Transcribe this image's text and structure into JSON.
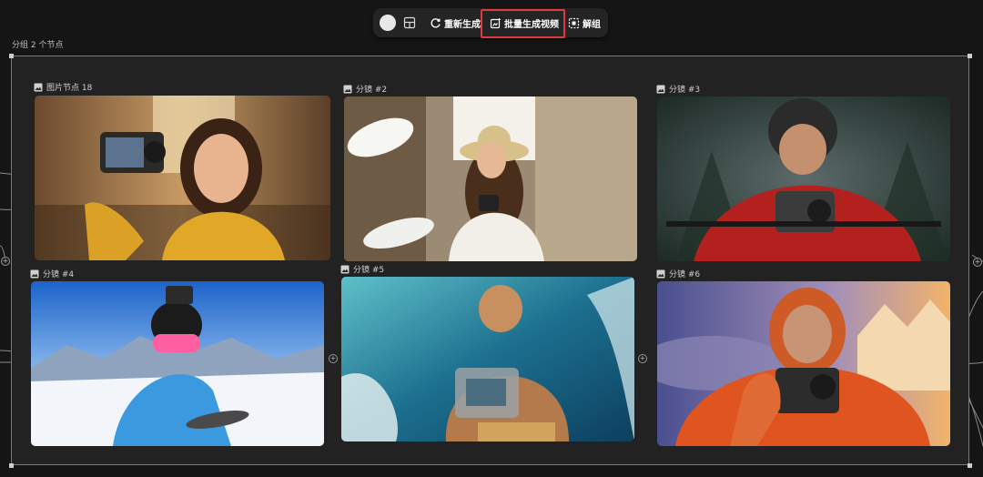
{
  "toolbar": {
    "color_swatch": "#e8e8e8",
    "regenerate_label": "重新生成",
    "batch_generate_video_label": "批量生成视频",
    "ungroup_label": "解组",
    "highlight_color": "#e0393e"
  },
  "group": {
    "label": "分组 2 个节点"
  },
  "nodes": [
    {
      "label": "图片节点 18",
      "icon": "image-icon"
    },
    {
      "label": "分镜 #2",
      "icon": "image-icon"
    },
    {
      "label": "分镜 #3",
      "icon": "image-icon"
    },
    {
      "label": "分镜 #4",
      "icon": "image-icon"
    },
    {
      "label": "分镜 #5",
      "icon": "image-icon"
    },
    {
      "label": "分镜 #6",
      "icon": "image-icon"
    }
  ]
}
